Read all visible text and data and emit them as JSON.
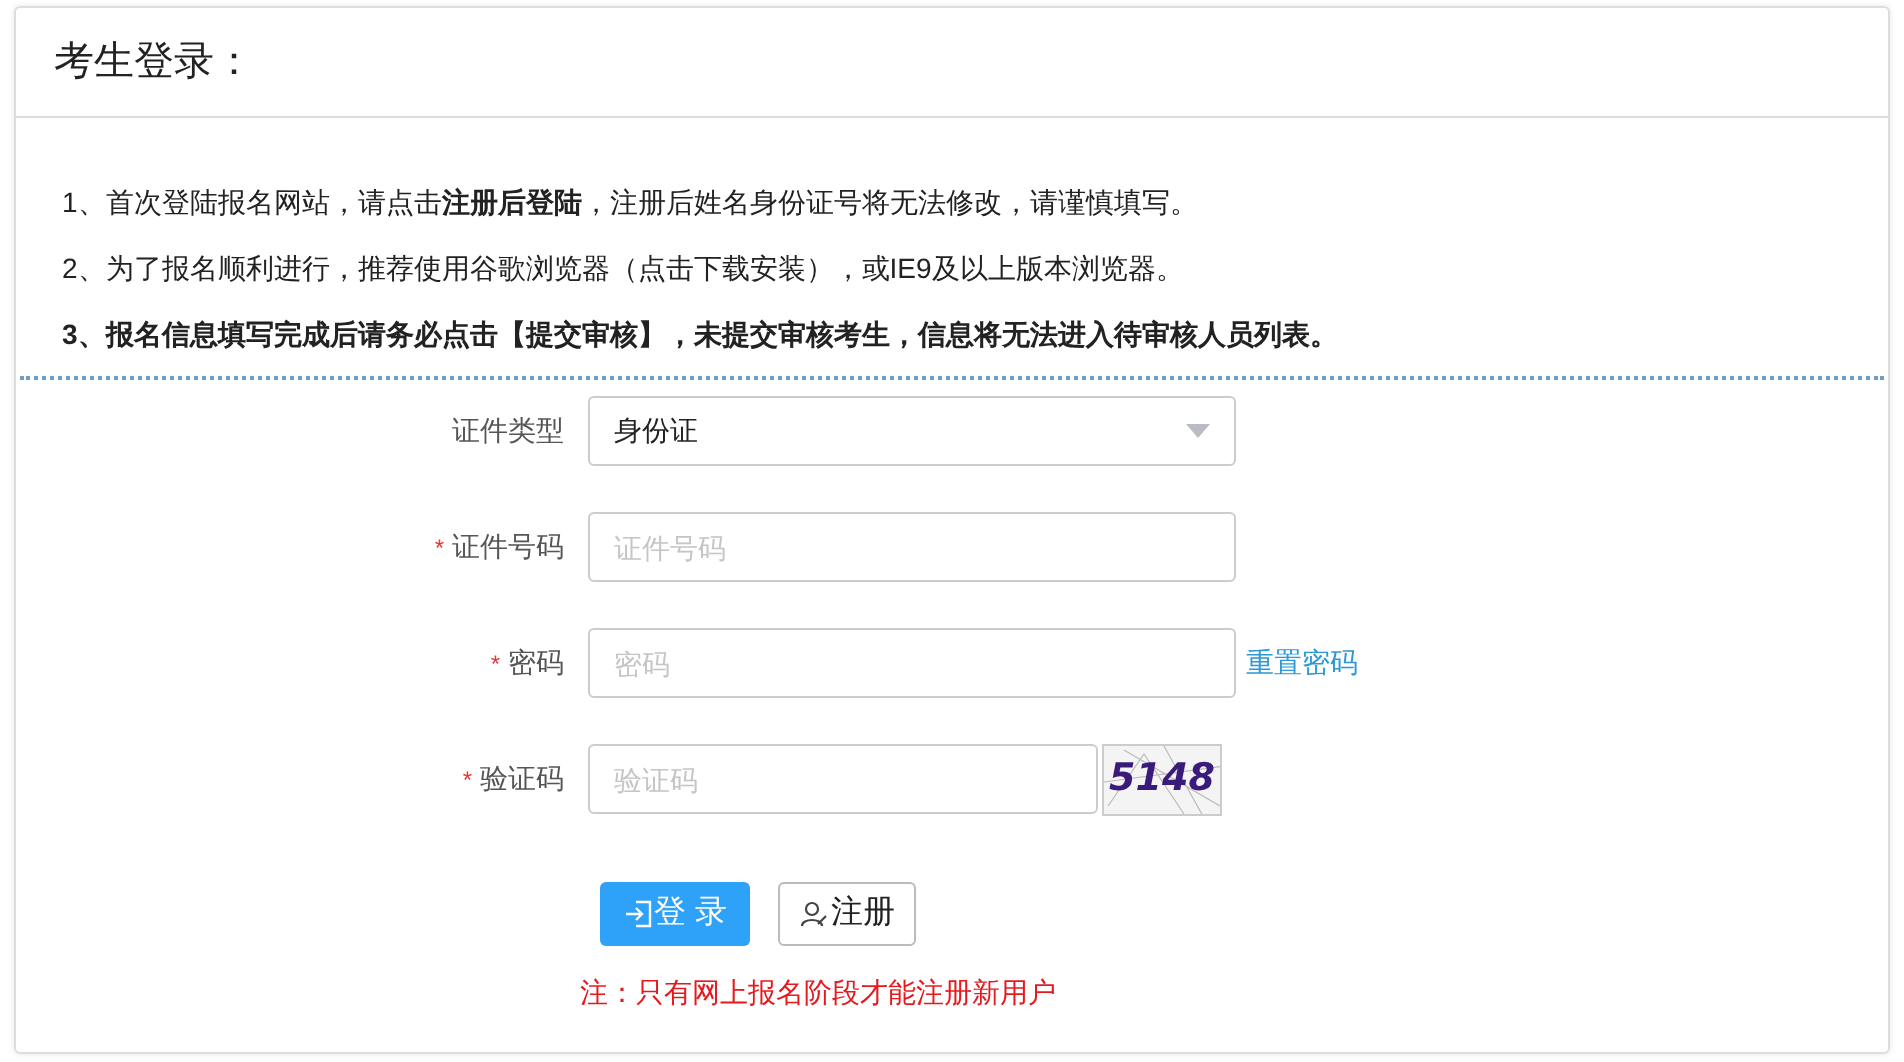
{
  "title": "考生登录：",
  "notes": [
    {
      "text": "1、首次登陆报名网站，请点击**注册后登陆**，注册后姓名身份证号将无法修改，请谨慎填写。",
      "bold": false
    },
    {
      "text": "2、为了报名顺利进行，推荐使用谷歌浏览器（点击下载安装），或IE9及以上版本浏览器。",
      "bold": false
    },
    {
      "text": "3、报名信息填写完成后请务必点击【提交审核】，未提交审核考生，信息将无法进入待审核人员列表。",
      "bold": true
    }
  ],
  "fields": [
    {
      "kind": "select",
      "label": "证件类型",
      "value": "身份证"
    },
    {
      "kind": "text",
      "label": "证件号码",
      "mark": "*",
      "placeholder": "证件号码"
    },
    {
      "kind": "password",
      "label": "密码",
      "mark": "*",
      "placeholder": "密码",
      "link": "重置密码"
    },
    {
      "kind": "captcha",
      "label": "验证码",
      "mark": "*",
      "placeholder": "验证码",
      "captcha": "5148"
    }
  ],
  "buttons": [
    {
      "kind": "primary",
      "label": "登 录"
    },
    {
      "kind": "default",
      "label": "注册"
    }
  ],
  "footnote": "注：只有网上报名阶段才能注册新用户"
}
